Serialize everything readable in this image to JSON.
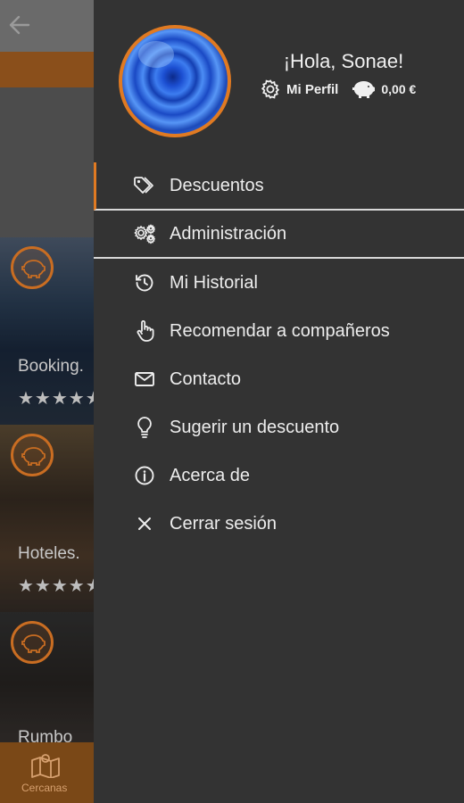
{
  "background": {
    "cards": [
      {
        "name": "Booking.",
        "stars": "★★★★★"
      },
      {
        "name": "Hoteles.",
        "stars": "★★★★★"
      },
      {
        "name": "Rumbo",
        "stars": ""
      }
    ],
    "bottom_nav": {
      "label": "Cercanas",
      "icon": "map-pin-icon"
    },
    "back_icon": "arrow-left-icon"
  },
  "drawer": {
    "greeting": "¡Hola, Sonae!",
    "profile_label": "Mi Perfil",
    "wallet_amount": "0,00 €",
    "menu": [
      {
        "label": "Descuentos",
        "icon": "tag-icon"
      },
      {
        "label": "Administración",
        "icon": "gears-icon"
      },
      {
        "label": "Mi Historial",
        "icon": "history-icon"
      },
      {
        "label": "Recomendar a compañeros",
        "icon": "hand-pointer-icon"
      },
      {
        "label": "Contacto",
        "icon": "envelope-icon"
      },
      {
        "label": "Sugerir un descuento",
        "icon": "lightbulb-icon"
      },
      {
        "label": "Acerca de",
        "icon": "info-icon"
      },
      {
        "label": "Cerrar sesión",
        "icon": "close-icon"
      }
    ]
  },
  "colors": {
    "accent": "#e07a22",
    "drawer_bg": "#333333",
    "text": "#ededed"
  }
}
